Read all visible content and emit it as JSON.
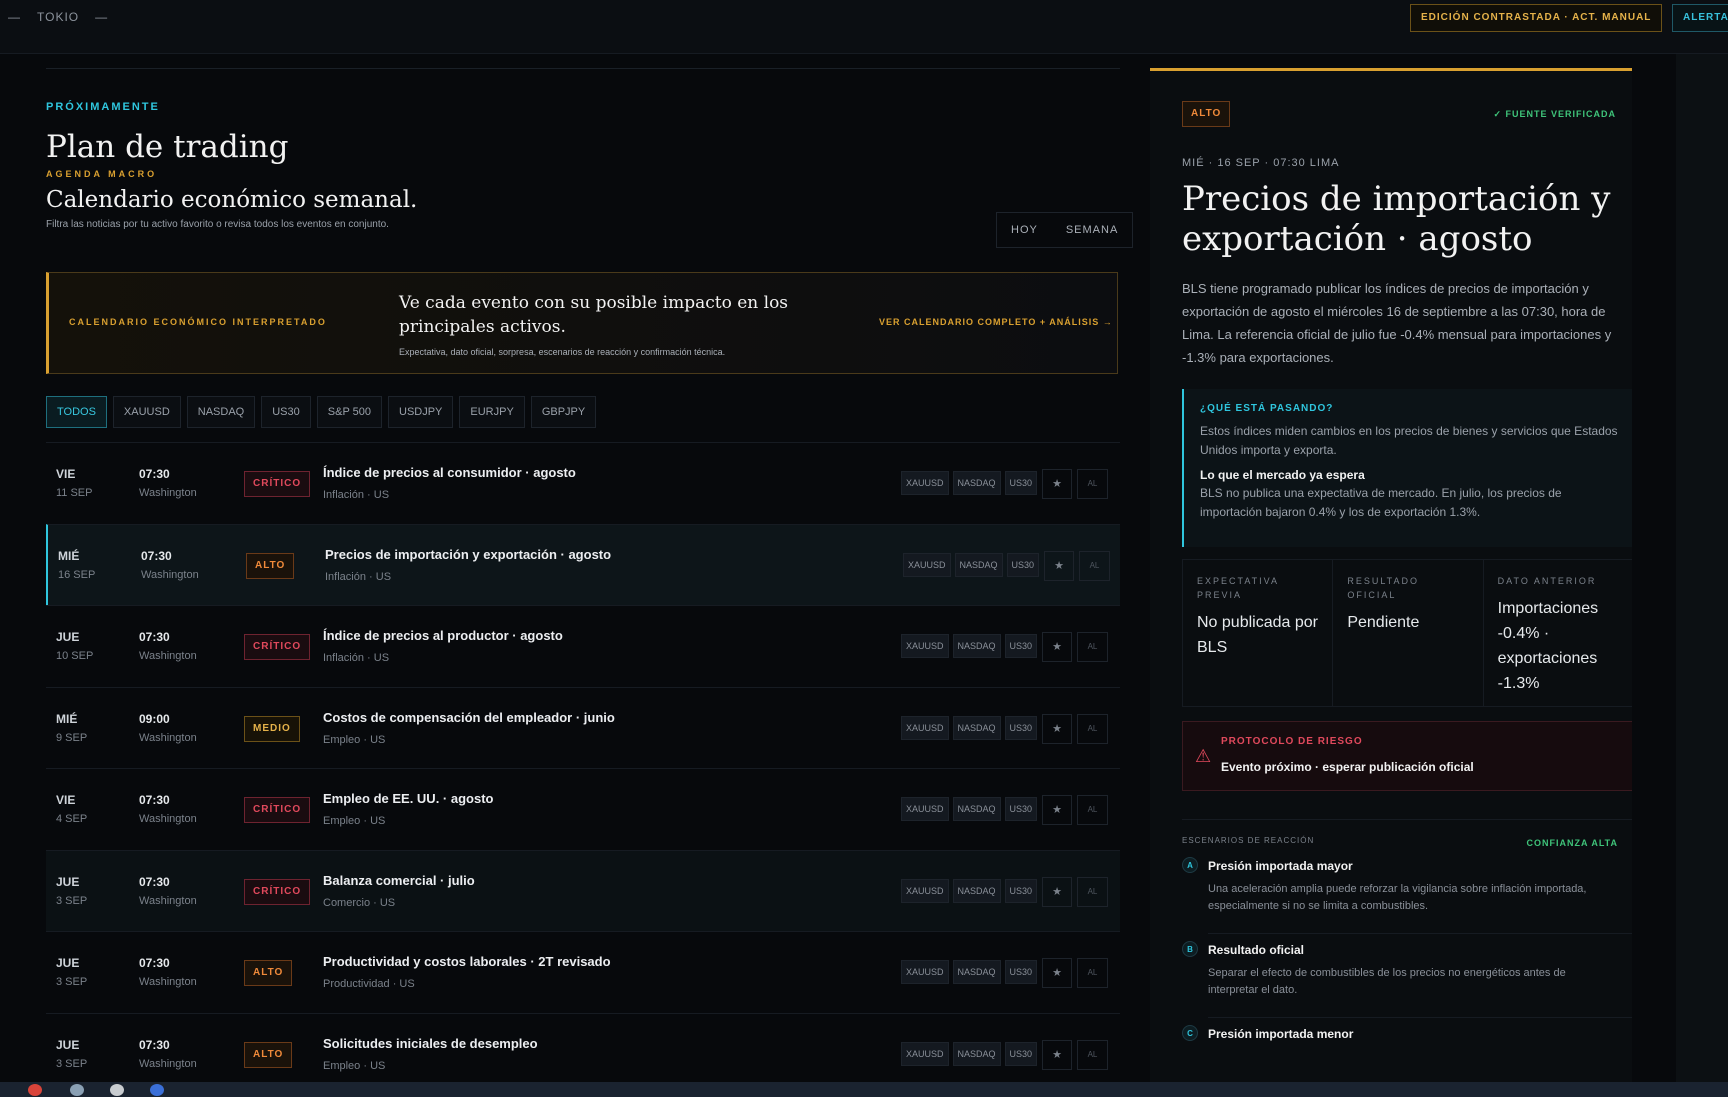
{
  "topbar": {
    "city": "TOKIO",
    "edition_label": "EDICIÓN CONTRASTADA · ACT. MANUAL",
    "alerts_label": "ALERTAS"
  },
  "header": {
    "eyebrow": "PRÓXIMAMENTE",
    "title": "Plan de trading",
    "agenda_label": "AGENDA MACRO",
    "subtitle": "Calendario económico semanal.",
    "helper": "Filtra las noticias por tu activo favorito o revisa todos los eventos en conjunto.",
    "toggle": [
      "HOY",
      "SEMANA"
    ]
  },
  "banner": {
    "tag": "CALENDARIO ECONÓMICO INTERPRETADO",
    "headline": "Ve cada evento con su posible impacto en los principales activos.",
    "sub": "Expectativa, dato oficial, sorpresa, escenarios de reacción y confirmación técnica.",
    "link": "VER CALENDARIO COMPLETO + ANÁLISIS →"
  },
  "filters": [
    "TODOS",
    "XAUUSD",
    "NASDAQ",
    "US30",
    "S&P 500",
    "USDJPY",
    "EURJPY",
    "GBPJPY"
  ],
  "events": [
    {
      "day": "VIE",
      "date": "11 SEP",
      "time": "07:30",
      "place": "Washington",
      "impact": "CRÍTICO",
      "level": "critico",
      "name": "Índice de precios al consumidor · agosto",
      "category": "Inflación · US",
      "assets": [
        "XAUUSD",
        "NASDAQ",
        "US30"
      ],
      "star": "★",
      "al": "AL"
    },
    {
      "day": "MIÉ",
      "date": "16 SEP",
      "time": "07:30",
      "place": "Washington",
      "impact": "ALTO",
      "level": "alto",
      "name": "Precios de importación y exportación · agosto",
      "category": "Inflación · US",
      "assets": [
        "XAUUSD",
        "NASDAQ",
        "US30"
      ],
      "star": "★",
      "al": "AL"
    },
    {
      "day": "JUE",
      "date": "10 SEP",
      "time": "07:30",
      "place": "Washington",
      "impact": "CRÍTICO",
      "level": "critico",
      "name": "Índice de precios al productor · agosto",
      "category": "Inflación · US",
      "assets": [
        "XAUUSD",
        "NASDAQ",
        "US30"
      ],
      "star": "★",
      "al": "AL"
    },
    {
      "day": "MIÉ",
      "date": "9 SEP",
      "time": "09:00",
      "place": "Washington",
      "impact": "MEDIO",
      "level": "medio",
      "name": "Costos de compensación del empleador · junio",
      "category": "Empleo · US",
      "assets": [
        "XAUUSD",
        "NASDAQ",
        "US30"
      ],
      "star": "★",
      "al": "AL"
    },
    {
      "day": "VIE",
      "date": "4 SEP",
      "time": "07:30",
      "place": "Washington",
      "impact": "CRÍTICO",
      "level": "critico",
      "name": "Empleo de EE. UU. · agosto",
      "category": "Empleo · US",
      "assets": [
        "XAUUSD",
        "NASDAQ",
        "US30"
      ],
      "star": "★",
      "al": "AL"
    },
    {
      "day": "JUE",
      "date": "3 SEP",
      "time": "07:30",
      "place": "Washington",
      "impact": "CRÍTICO",
      "level": "critico",
      "name": "Balanza comercial · julio",
      "category": "Comercio · US",
      "assets": [
        "XAUUSD",
        "NASDAQ",
        "US30"
      ],
      "star": "★",
      "al": "AL"
    },
    {
      "day": "JUE",
      "date": "3 SEP",
      "time": "07:30",
      "place": "Washington",
      "impact": "ALTO",
      "level": "alto",
      "name": "Productividad y costos laborales · 2T revisado",
      "category": "Productividad · US",
      "assets": [
        "XAUUSD",
        "NASDAQ",
        "US30"
      ],
      "star": "★",
      "al": "AL"
    },
    {
      "day": "JUE",
      "date": "3 SEP",
      "time": "07:30",
      "place": "Washington",
      "impact": "ALTO",
      "level": "alto",
      "name": "Solicitudes iniciales de desempleo",
      "category": "Empleo · US",
      "assets": [
        "XAUUSD",
        "NASDAQ",
        "US30"
      ],
      "star": "★",
      "al": "AL"
    }
  ],
  "detail": {
    "badge": "ALTO",
    "verified": "✓ FUENTE VERIFICADA",
    "meta": "MIÉ · 16 SEP · 07:30 LIMA",
    "title": "Precios de importación y exportación · agosto",
    "description": "BLS tiene programado publicar los índices de precios de importación y exportación de agosto el miércoles 16 de septiembre a las 07:30, hora de Lima. La referencia oficial de julio fue -0.4% mensual para importaciones y -1.3% para exportaciones.",
    "what_title": "¿QUÉ ESTÁ PASANDO?",
    "what_desc": "Estos índices miden cambios en los precios de bienes y servicios que Estados Unidos importa y exporta.",
    "expect_title": "Lo que el mercado ya espera",
    "expect_desc": "BLS no publica una expectativa de mercado. En julio, los precios de importación bajaron 0.4% y los de exportación 1.3%.",
    "stats": [
      {
        "label": "EXPECTATIVA PREVIA",
        "value": "No publicada por BLS"
      },
      {
        "label": "RESULTADO OFICIAL",
        "value": "Pendiente"
      },
      {
        "label": "DATO ANTERIOR",
        "value": "Importaciones -0.4% · exportaciones -1.3%"
      }
    ],
    "risk_title": "PROTOCOLO DE RIESGO",
    "risk_value": "Evento próximo · esperar publicación oficial",
    "scenarios_label": "ESCENARIOS DE REACCIÓN",
    "confidence": "CONFIANZA ALTA",
    "scenarios": [
      {
        "letter": "A",
        "title": "Presión importada mayor",
        "desc": "Una aceleración amplia puede reforzar la vigilancia sobre inflación importada, especialmente si no se limita a combustibles."
      },
      {
        "letter": "B",
        "title": "Resultado oficial",
        "desc": "Separar el efecto de combustibles de los precios no energéticos antes de interpretar el dato."
      },
      {
        "letter": "C",
        "title": "Presión importada menor",
        "desc": ""
      }
    ]
  },
  "colors": {
    "accent_cyan": "#2fc6de",
    "accent_gold": "#d9a030",
    "critical": "#e0495c",
    "high": "#f08a3a",
    "medium": "#e5b24a",
    "verified": "#3fc47a"
  }
}
